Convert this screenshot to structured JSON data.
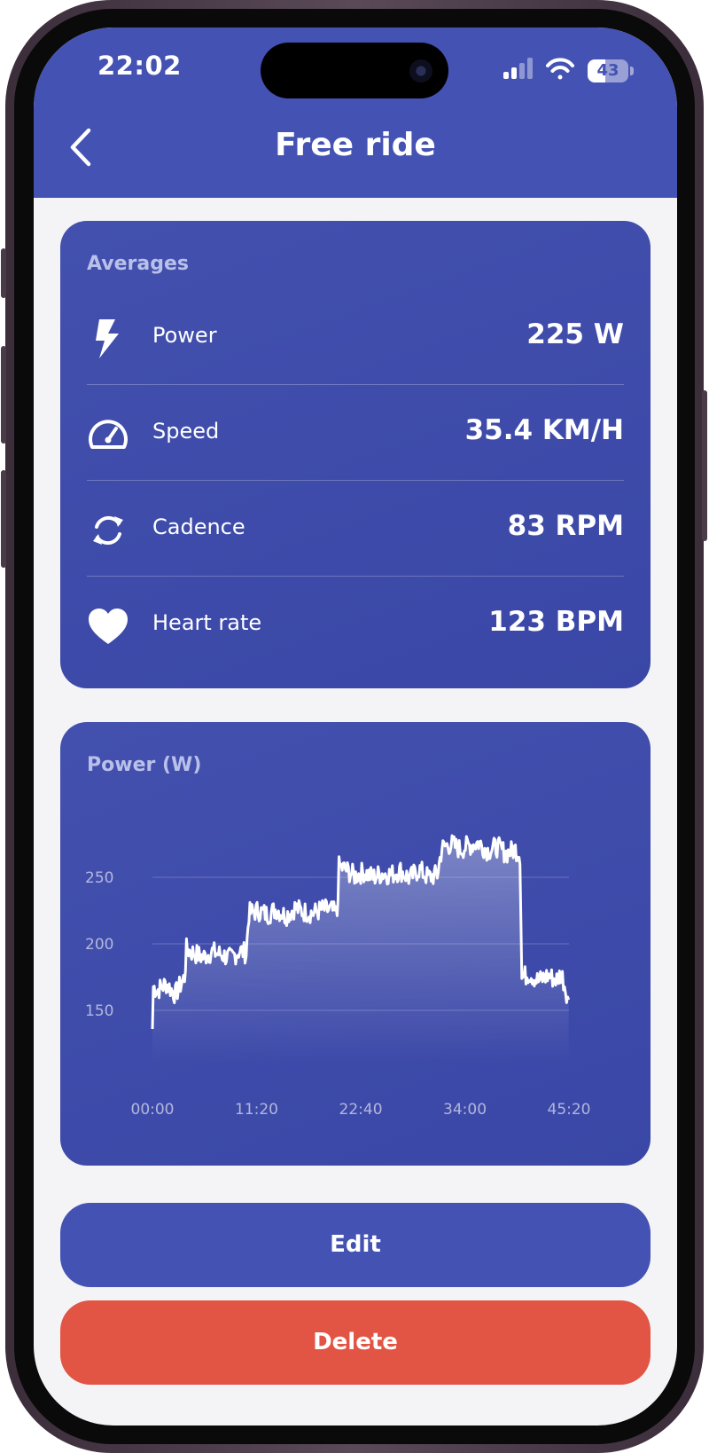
{
  "status_bar": {
    "time": "22:02",
    "battery": "43",
    "battery_level": 0.43
  },
  "header": {
    "title": "Free ride"
  },
  "averages": {
    "label": "Averages",
    "items": [
      {
        "name": "Power",
        "value": "225 W",
        "icon": "lightning-bolt-icon"
      },
      {
        "name": "Speed",
        "value": "35.4 KM/H",
        "icon": "speedometer-icon"
      },
      {
        "name": "Cadence",
        "value": "83 RPM",
        "icon": "cycle-arrows-icon"
      },
      {
        "name": "Heart rate",
        "value": "123 BPM",
        "icon": "heart-icon"
      }
    ]
  },
  "chart_data": {
    "type": "area",
    "title": "Power (W)",
    "xlabel": "",
    "ylabel": "",
    "x_tick_labels": [
      "00:00",
      "11:20",
      "22:40",
      "34:00",
      "45:20"
    ],
    "x_ticks_minutes": [
      0,
      11.33,
      22.67,
      34,
      45.33
    ],
    "y_ticks": [
      150,
      200,
      250
    ],
    "xlim": [
      0,
      45.33
    ],
    "ylim": [
      110,
      300
    ],
    "grid": true,
    "series": [
      {
        "x": [
          0,
          0.1,
          0.5,
          1.5,
          2.5,
          3.5,
          3.7,
          4.5,
          5.5,
          6.5,
          7.5,
          8.5,
          9.5,
          10.2,
          10.5,
          11.5,
          12.5,
          13.5,
          14.5,
          15.5,
          16.5,
          17.5,
          18.5,
          19.5,
          20.1,
          20.3,
          21,
          22,
          23,
          24,
          25,
          26,
          27,
          28,
          29,
          30,
          31,
          31.5,
          32.5,
          33.5,
          34.5,
          35.5,
          36.5,
          37.5,
          38.5,
          39.5,
          40,
          40.2,
          41,
          42,
          43,
          44,
          44.5,
          45.3
        ],
        "values": [
          136,
          168,
          165,
          170,
          162,
          175,
          196,
          193,
          190,
          194,
          192,
          189,
          195,
          193,
          223,
          225,
          222,
          226,
          221,
          227,
          224,
          223,
          226,
          225,
          222,
          258,
          256,
          251,
          254,
          250,
          253,
          252,
          255,
          249,
          256,
          250,
          252,
          272,
          275,
          271,
          274,
          276,
          270,
          273,
          268,
          271,
          267,
          174,
          178,
          172,
          176,
          173,
          178,
          158
        ]
      }
    ]
  },
  "actions": {
    "edit": "Edit",
    "delete": "Delete"
  },
  "colors": {
    "primary": "#4452b3",
    "card": "#3d4aa9",
    "danger": "#e25544",
    "background": "#f4f4f6"
  }
}
